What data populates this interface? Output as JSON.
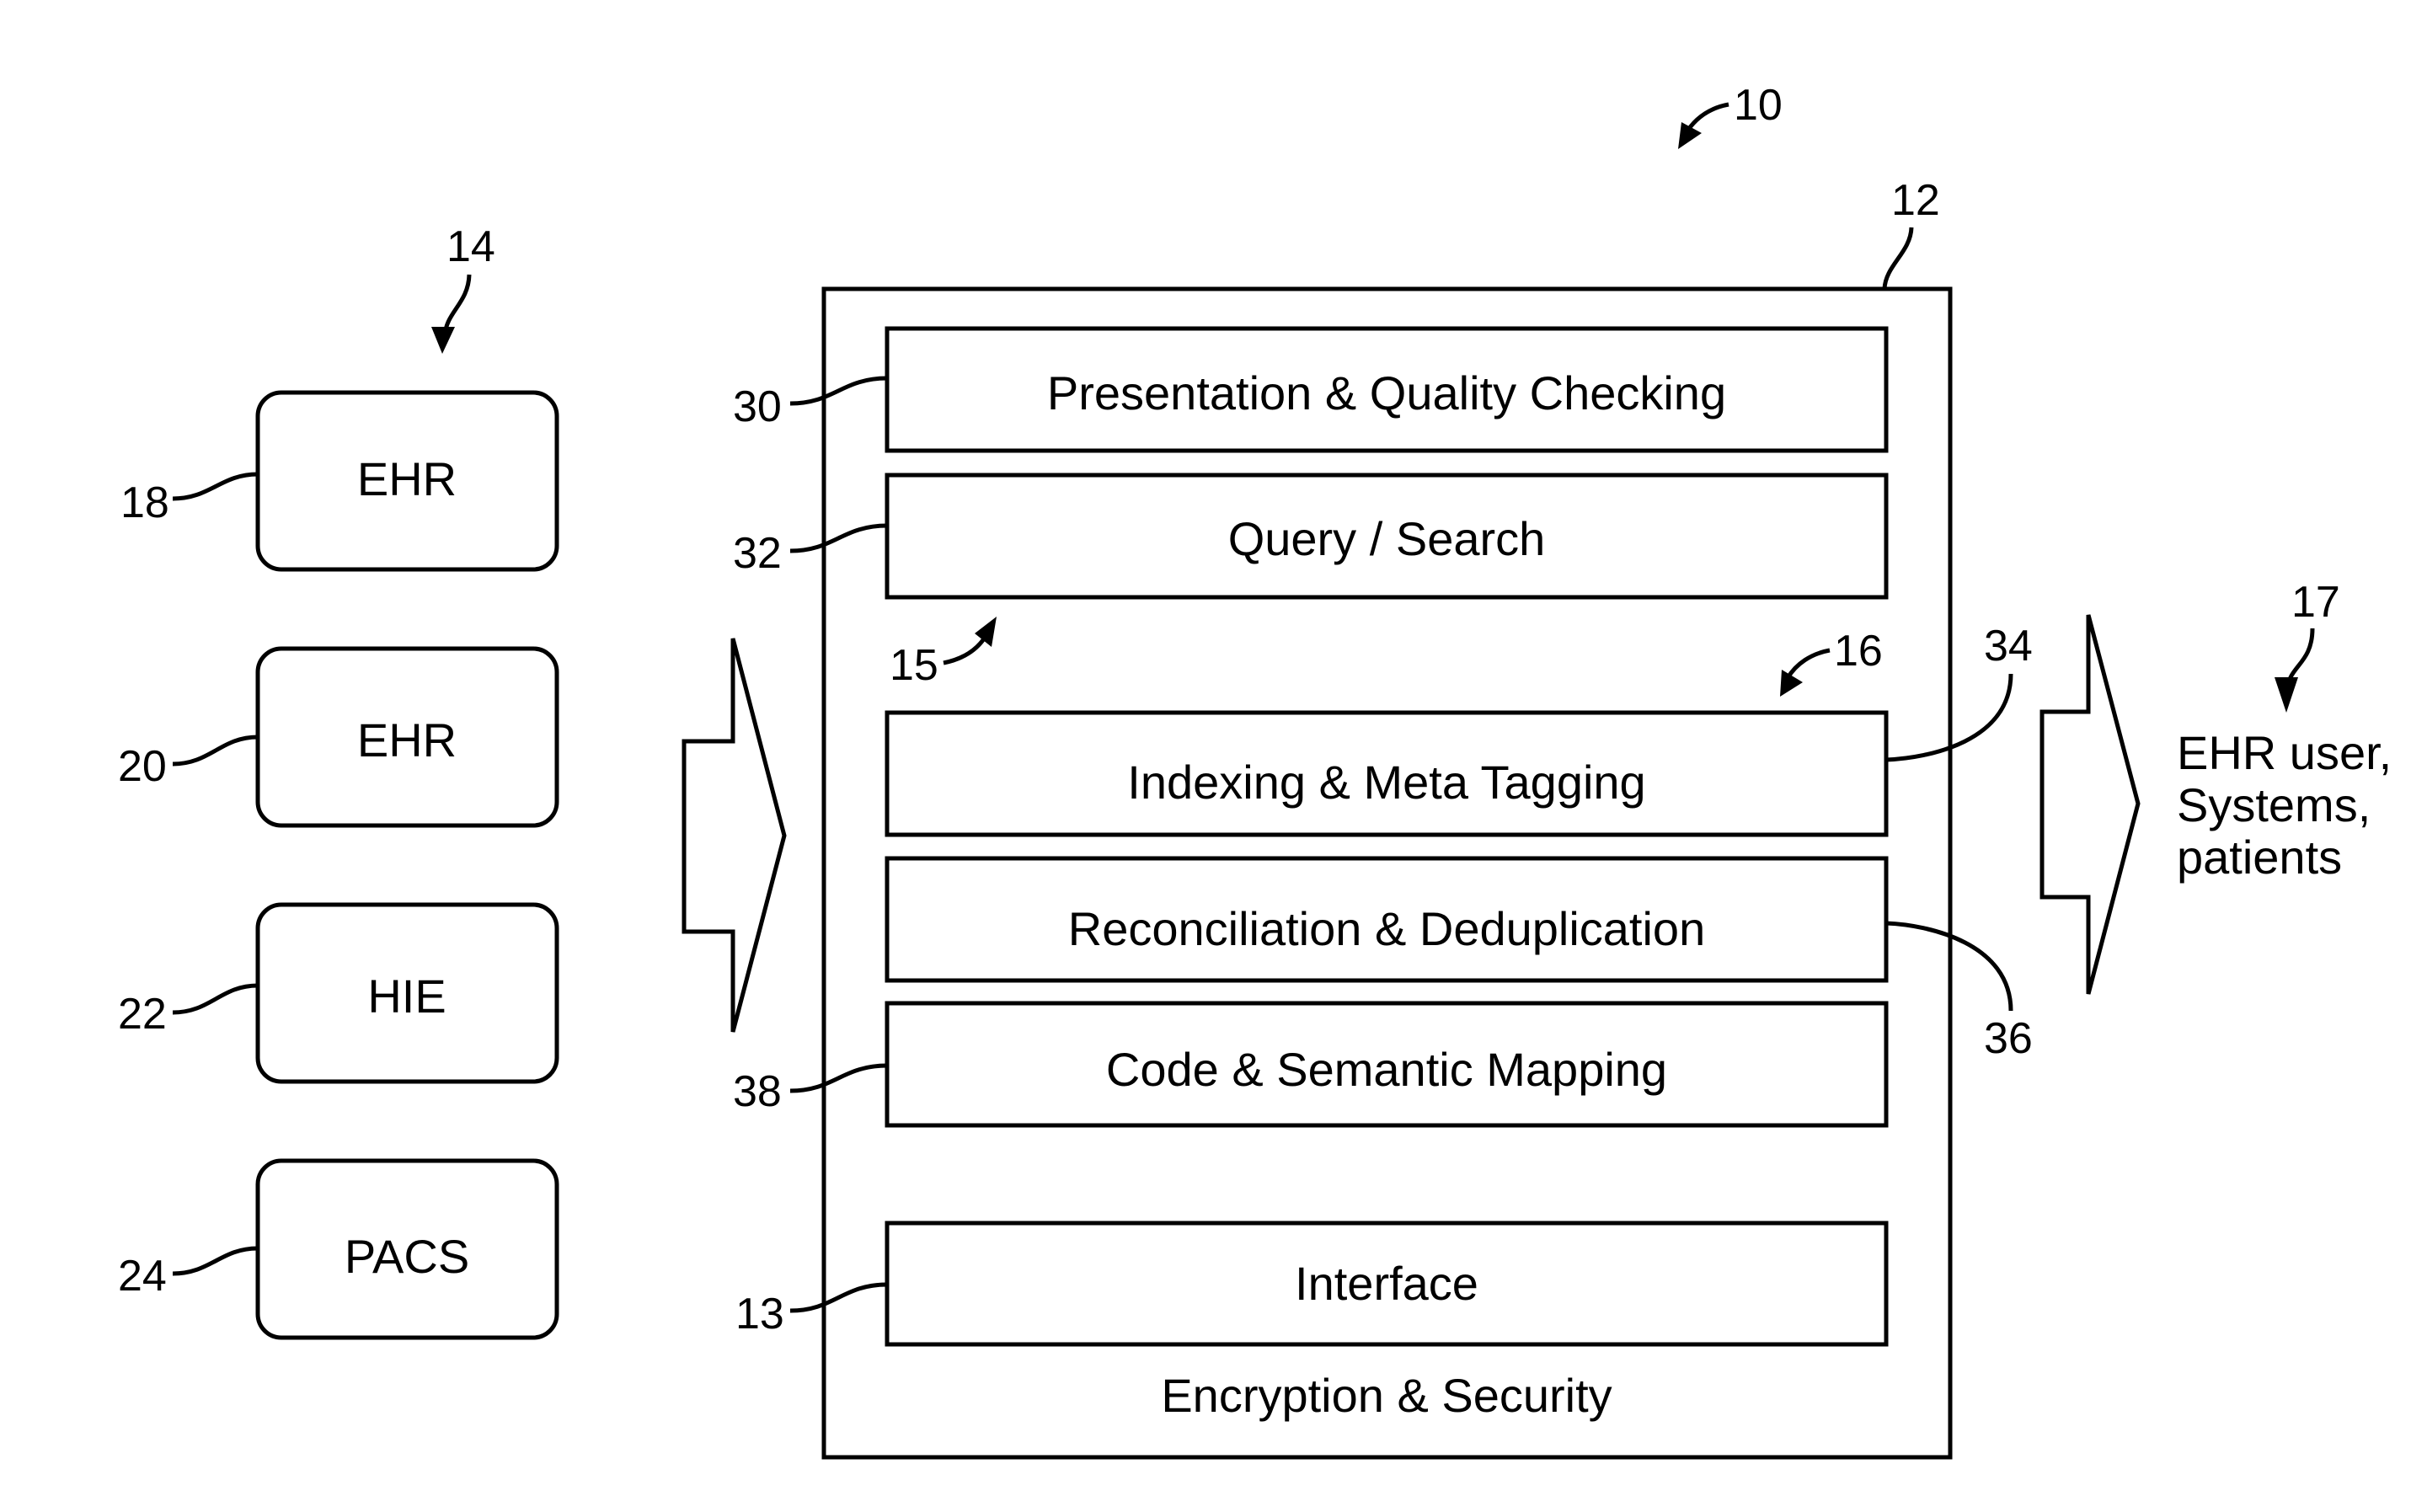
{
  "figure": {
    "system_ref": "10",
    "platform_ref": "12",
    "sources_ref": "14",
    "consumers_ref": "17",
    "layer_group_upper_ref": "15",
    "layer_group_lower_ref": "16"
  },
  "sources": [
    {
      "ref": "18",
      "label": "EHR"
    },
    {
      "ref": "20",
      "label": "EHR"
    },
    {
      "ref": "22",
      "label": "HIE"
    },
    {
      "ref": "24",
      "label": "PACS"
    }
  ],
  "layers": [
    {
      "ref": "30",
      "label": "Presentation & Quality Checking"
    },
    {
      "ref": "32",
      "label": "Query / Search"
    },
    {
      "ref": "34",
      "label": "Indexing & Meta Tagging"
    },
    {
      "ref": "36",
      "label": "Reconciliation & Deduplication"
    },
    {
      "ref": "38",
      "label": "Code & Semantic Mapping"
    },
    {
      "ref": "13",
      "label": "Interface"
    }
  ],
  "platform_footer": "Encryption & Security",
  "consumers": {
    "lines": [
      "EHR user,",
      "Systems,",
      "patients"
    ]
  }
}
